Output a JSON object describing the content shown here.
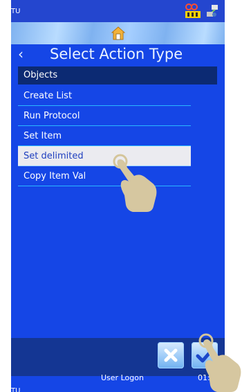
{
  "status": {
    "left_text": "TU",
    "icons": [
      "battery-group-icon",
      "network-icon"
    ]
  },
  "header": {
    "home_icon": "home-icon",
    "title": "Select Action Type",
    "back": "‹"
  },
  "list": {
    "header": "Objects",
    "items": [
      {
        "label": "Create List",
        "selected": false
      },
      {
        "label": "Run Protocol",
        "selected": false
      },
      {
        "label": "Set Item",
        "selected": false
      },
      {
        "label": "Set delimited",
        "selected": true
      },
      {
        "label": "Copy Item Val",
        "selected": false
      }
    ]
  },
  "footer": {
    "cancel_icon": "cancel-icon",
    "ok_icon": "checkmark-icon",
    "user_logon": "User Logon",
    "time": "01:02",
    "bottom_left": "TU"
  },
  "colors": {
    "background": "#1546e6",
    "header_row": "#0c2a73",
    "selected_row": "#ebebf0",
    "divider": "#29b7ff"
  }
}
